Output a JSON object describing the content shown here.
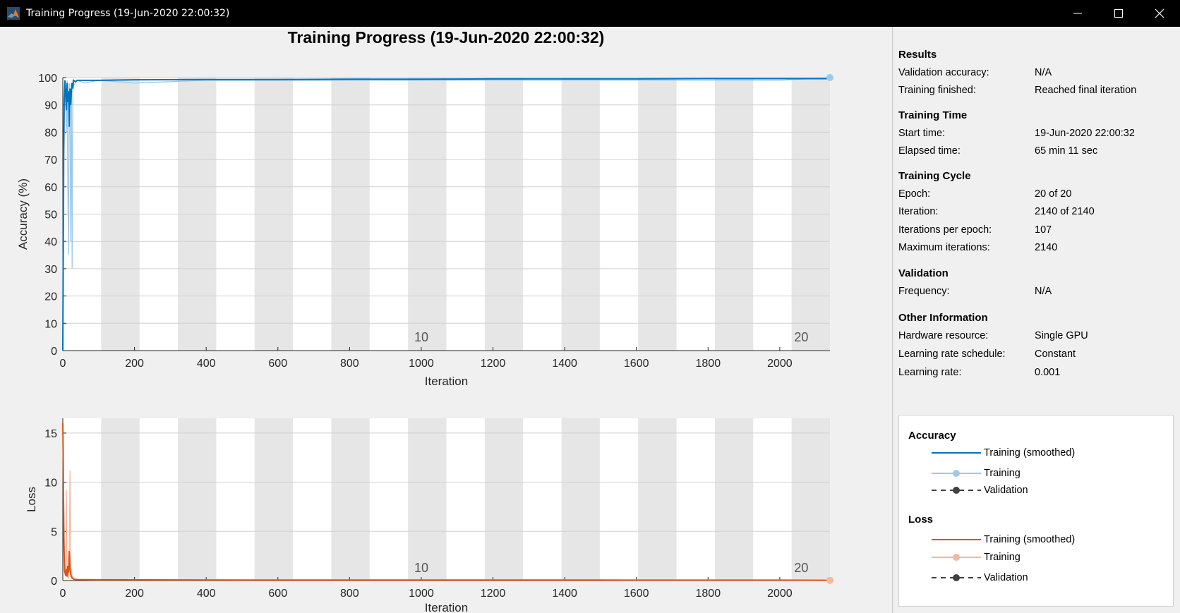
{
  "window": {
    "title": "Training Progress (19-Jun-2020 22:00:32)"
  },
  "plot_title": "Training Progress (19-Jun-2020 22:00:32)",
  "results": {
    "heading": "Results",
    "rows": [
      {
        "label": "Validation accuracy:",
        "value": "N/A"
      },
      {
        "label": "Training finished:",
        "value": "Reached final iteration"
      }
    ]
  },
  "training_time": {
    "heading": "Training Time",
    "rows": [
      {
        "label": "Start time:",
        "value": "19-Jun-2020 22:00:32"
      },
      {
        "label": "Elapsed time:",
        "value": "65 min 11 sec"
      }
    ]
  },
  "training_cycle": {
    "heading": "Training Cycle",
    "rows": [
      {
        "label": "Epoch:",
        "value": "20 of 20"
      },
      {
        "label": "Iteration:",
        "value": "2140 of 2140"
      },
      {
        "label": "Iterations per epoch:",
        "value": "107"
      },
      {
        "label": "Maximum iterations:",
        "value": "2140"
      }
    ]
  },
  "validation": {
    "heading": "Validation",
    "rows": [
      {
        "label": "Frequency:",
        "value": "N/A"
      }
    ]
  },
  "other_info": {
    "heading": "Other Information",
    "rows": [
      {
        "label": "Hardware resource:",
        "value": "Single GPU"
      },
      {
        "label": "Learning rate schedule:",
        "value": "Constant"
      },
      {
        "label": "Learning rate:",
        "value": "0.001"
      }
    ]
  },
  "legend": {
    "accuracy_title": "Accuracy",
    "loss_title": "Loss",
    "smoothed": "Training (smoothed)",
    "training": "Training",
    "validation": "Validation"
  },
  "colors": {
    "accuracy_smoothed": "#0072bd",
    "accuracy_raw": "#9fc9ea",
    "loss_smoothed": "#d95319",
    "loss_raw": "#f2b8a0",
    "validation": "#404040",
    "epoch_band": "#e6e6e6"
  },
  "chart_data": [
    {
      "type": "line",
      "xlabel": "Iteration",
      "ylabel": "Accuracy (%)",
      "xlim": [
        0,
        2140
      ],
      "ylim": [
        0,
        100
      ],
      "xticks": [
        0,
        200,
        400,
        600,
        800,
        1000,
        1200,
        1400,
        1600,
        1800,
        2000
      ],
      "yticks": [
        0,
        10,
        20,
        30,
        40,
        50,
        60,
        70,
        80,
        90,
        100
      ],
      "iterations_per_epoch": 107,
      "epoch_labels": [
        {
          "epoch": "10",
          "x": 1000
        },
        {
          "epoch": "20",
          "x": 2060
        }
      ],
      "series": [
        {
          "name": "Training (smoothed)",
          "x": [
            0,
            1,
            2,
            4,
            6,
            8,
            10,
            12,
            14,
            16,
            18,
            20,
            22,
            25,
            28,
            30,
            35,
            40,
            60,
            100,
            200,
            400,
            600,
            800,
            1000,
            1200,
            1400,
            1600,
            1800,
            2000,
            2140
          ],
          "y": [
            0,
            30,
            70,
            92,
            99,
            94,
            88,
            98,
            91,
            95,
            82,
            96,
            90,
            98,
            96,
            99,
            98.5,
            99,
            99,
            99,
            99.2,
            99.3,
            99.3,
            99.4,
            99.4,
            99.5,
            99.5,
            99.5,
            99.6,
            99.6,
            99.6
          ]
        },
        {
          "name": "Training",
          "x": [
            0,
            5,
            8,
            10,
            12,
            14,
            16,
            18,
            20,
            22,
            24,
            26,
            28,
            30,
            40,
            60,
            100,
            200,
            400,
            600,
            800,
            1000,
            1200,
            1400,
            1600,
            1800,
            2000,
            2140
          ],
          "y": [
            0,
            90,
            96,
            80,
            99,
            60,
            35,
            98,
            85,
            40,
            97,
            30,
            99,
            97,
            99,
            98,
            99,
            98,
            99,
            99,
            99,
            99,
            99,
            99,
            99,
            99,
            99,
            100
          ]
        }
      ]
    },
    {
      "type": "line",
      "xlabel": "Iteration",
      "ylabel": "Loss",
      "xlim": [
        0,
        2140
      ],
      "ylim": [
        0,
        16.5
      ],
      "xticks": [
        0,
        200,
        400,
        600,
        800,
        1000,
        1200,
        1400,
        1600,
        1800,
        2000
      ],
      "yticks": [
        0,
        5,
        10,
        15
      ],
      "iterations_per_epoch": 107,
      "epoch_labels": [
        {
          "epoch": "10",
          "x": 1000
        },
        {
          "epoch": "20",
          "x": 2060
        }
      ],
      "series": [
        {
          "name": "Training (smoothed)",
          "x": [
            0,
            1,
            2,
            3,
            5,
            8,
            10,
            12,
            14,
            16,
            18,
            20,
            22,
            25,
            30,
            40,
            100,
            500,
            1000,
            1500,
            2000,
            2140
          ],
          "y": [
            16,
            13,
            8,
            4,
            1,
            0.5,
            1.2,
            0.4,
            1.5,
            0.8,
            3,
            1.2,
            0.6,
            0.3,
            0.15,
            0.1,
            0.08,
            0.06,
            0.05,
            0.05,
            0.04,
            0.03
          ]
        },
        {
          "name": "Training",
          "x": [
            0,
            5,
            8,
            10,
            12,
            14,
            16,
            18,
            20,
            22,
            24,
            26,
            28,
            30,
            40,
            100,
            500,
            1000,
            1500,
            2000,
            2140
          ],
          "y": [
            16,
            2,
            0.5,
            9.2,
            0.3,
            0.8,
            0.2,
            2.5,
            11.2,
            0.4,
            1.2,
            0.2,
            0.5,
            0.1,
            0.1,
            0.05,
            0.05,
            0.05,
            0.05,
            0.04,
            0.02
          ]
        }
      ]
    }
  ]
}
